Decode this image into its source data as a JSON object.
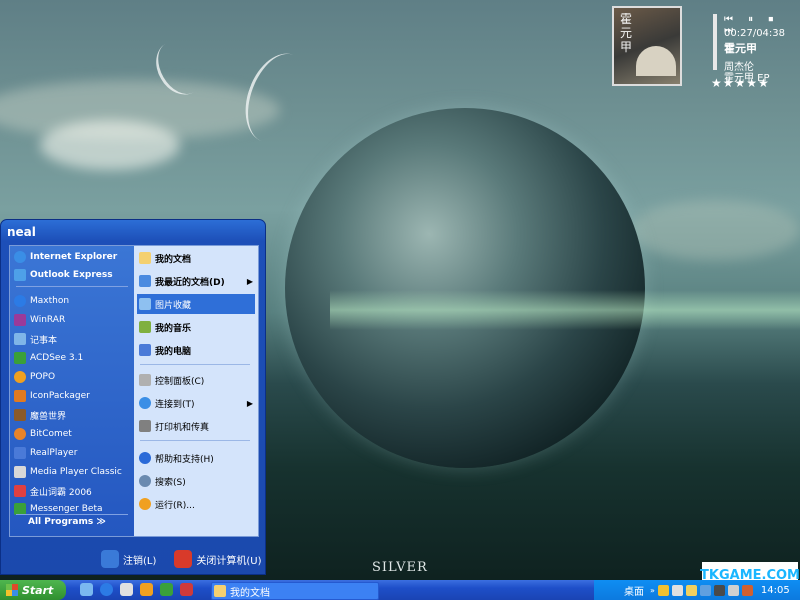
{
  "desktop": {
    "brand_text": "SILVER",
    "watermark": "TKGAME.COM"
  },
  "media_widget": {
    "cover_glyph": "霍元甲",
    "controls": "⏮ ⏸ ⏹ ⏭",
    "time": "00:27/04:38",
    "song": "霍元甲",
    "artist": "周杰伦",
    "album": "霍元甲 EP",
    "stars": "★★★★★"
  },
  "start_menu": {
    "user": "neal",
    "left_items": [
      {
        "label": "Internet Explorer",
        "icon": "internet-explorer-icon",
        "color": "#3a8ee6"
      },
      {
        "label": "Outlook Express",
        "icon": "outlook-express-icon",
        "color": "#4ea0e8"
      },
      {
        "label": "Maxthon",
        "icon": "maxthon-icon",
        "color": "#2c7be5"
      },
      {
        "label": "WinRAR",
        "icon": "winrar-icon",
        "color": "#9a3a9a"
      },
      {
        "label": "记事本",
        "icon": "notepad-icon",
        "color": "#7fb5e8"
      },
      {
        "label": "ACDSee 3.1",
        "icon": "acdsee-icon",
        "color": "#3aa03a"
      },
      {
        "label": "POPO",
        "icon": "popo-icon",
        "color": "#f0a020"
      },
      {
        "label": "IconPackager",
        "icon": "iconpackager-icon",
        "color": "#e07a20"
      },
      {
        "label": "魔兽世界",
        "icon": "world-of-warcraft-icon",
        "color": "#8a5a2a"
      },
      {
        "label": "BitComet",
        "icon": "bitcomet-icon",
        "color": "#e8842a"
      },
      {
        "label": "RealPlayer",
        "icon": "realplayer-icon",
        "color": "#4a7ad8"
      },
      {
        "label": "Media Player Classic",
        "icon": "media-player-classic-icon",
        "color": "#d8d8d8"
      },
      {
        "label": "金山词霸 2006",
        "icon": "kingsoft-powerword-icon",
        "color": "#e04040"
      },
      {
        "label": "Messenger Beta",
        "icon": "messenger-icon",
        "color": "#3aa03a"
      }
    ],
    "all_programs": "All Programs",
    "all_programs_arrow": "≫",
    "right_items": [
      {
        "label": "我的文档",
        "icon": "my-documents-icon",
        "color": "#f4d070"
      },
      {
        "label": "我最近的文档(D)",
        "icon": "recent-documents-icon",
        "color": "#4a8ae0",
        "arrow": "▶"
      },
      {
        "label": "图片收藏",
        "icon": "my-pictures-icon",
        "color": "#8ec0f0"
      },
      {
        "label": "我的音乐",
        "icon": "my-music-icon",
        "color": "#7fb040"
      },
      {
        "label": "我的电脑",
        "icon": "my-computer-icon",
        "color": "#4a7ad8"
      },
      {
        "label": "控制面板(C)",
        "icon": "control-panel-icon",
        "color": "#b0b0b0"
      },
      {
        "label": "连接到(T)",
        "icon": "connect-to-icon",
        "color": "#3a8ee6",
        "arrow": "▶"
      },
      {
        "label": "打印机和传真",
        "icon": "printers-icon",
        "color": "#808080"
      },
      {
        "label": "帮助和支持(H)",
        "icon": "help-icon",
        "color": "#2a6ad8"
      },
      {
        "label": "搜索(S)",
        "icon": "search-icon",
        "color": "#6a8ab0"
      },
      {
        "label": "运行(R)...",
        "icon": "run-icon",
        "color": "#f0a020"
      }
    ],
    "logoff": "注销(L)",
    "shutdown": "关闭计算机(U)"
  },
  "taskbar": {
    "start": "Start",
    "task": "我的文档",
    "desktop_label": "桌面",
    "clock": "14:05"
  },
  "colors": {
    "taskbar_blue": "#1e4fc9",
    "start_green": "#2f8f2f",
    "selection": "#2f6fd8"
  }
}
